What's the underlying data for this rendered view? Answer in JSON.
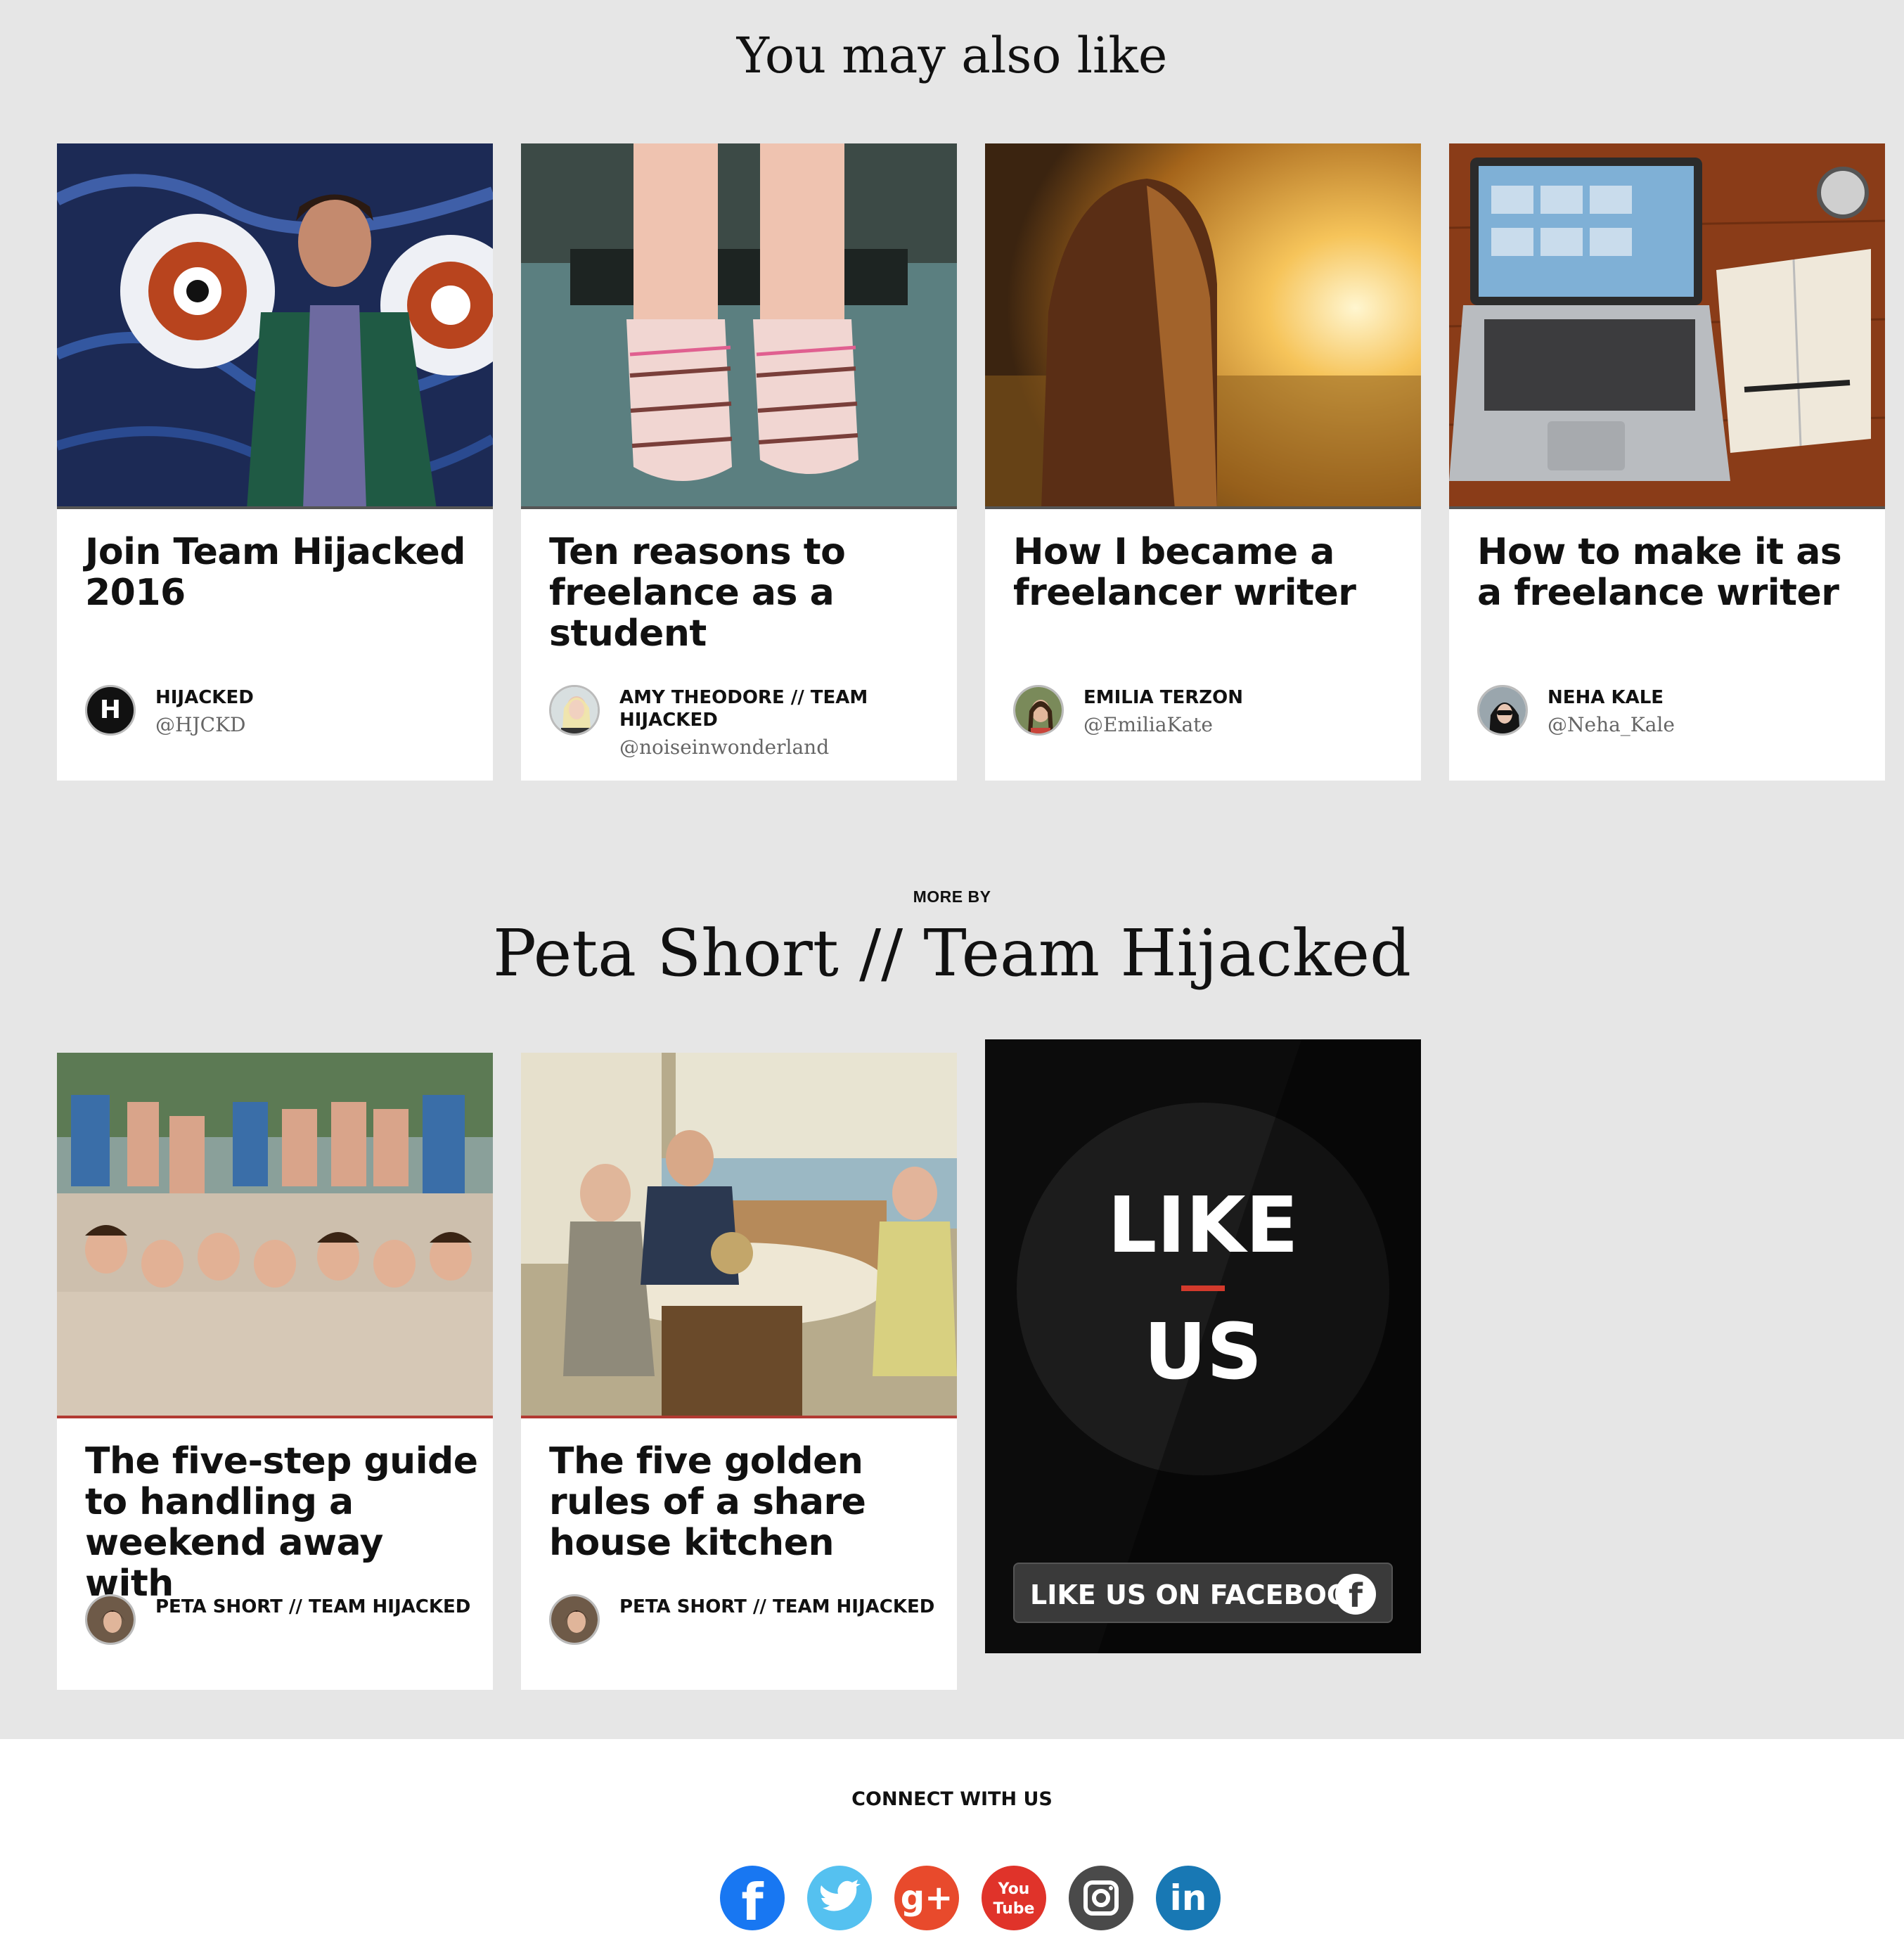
{
  "also_like": {
    "title": "You may also like",
    "cards": [
      {
        "title": "Join Team Hijacked 2016",
        "author": "HIJACKED",
        "handle": "@HJCKD",
        "avatar_letter": "H"
      },
      {
        "title": "Ten reasons to freelance as a student",
        "author": "AMY THEODORE // TEAM HIJACKED",
        "handle": "@noiseinwonderland"
      },
      {
        "title": "How I became a freelancer writer",
        "author": "EMILIA TERZON",
        "handle": "@EmiliaKate"
      },
      {
        "title": "How to make it as a freelance writer",
        "author": "NEHA KALE",
        "handle": "@Neha_Kale"
      }
    ]
  },
  "more_by": {
    "kicker": "MORE BY",
    "author": "Peta Short // Team Hijacked",
    "cards": [
      {
        "title": "The five-step guide to handling a weekend away with",
        "author": "PETA SHORT // TEAM HIJACKED"
      },
      {
        "title": "The five golden rules of a share house kitchen",
        "author": "PETA SHORT // TEAM HIJACKED"
      }
    ]
  },
  "facebook_promo": {
    "like": "LIKE",
    "us": "US",
    "button_label": "LIKE US ON FACEBOOK",
    "button_icon": "f"
  },
  "footer": {
    "connect_label": "CONNECT WITH US",
    "socials": [
      {
        "name": "facebook-icon",
        "glyph": "f",
        "color": "#1877f2"
      },
      {
        "name": "twitter-icon",
        "glyph": "🐦",
        "color": "#55c1f0"
      },
      {
        "name": "google-plus-icon",
        "glyph": "g+",
        "color": "#e84a2c"
      },
      {
        "name": "youtube-icon",
        "glyph": "You\nTube",
        "color": "#e0332a"
      },
      {
        "name": "instagram-icon",
        "glyph": "◙",
        "color": "#4a4a4a"
      },
      {
        "name": "linkedin-icon",
        "glyph": "in",
        "color": "#1878b4"
      }
    ]
  }
}
